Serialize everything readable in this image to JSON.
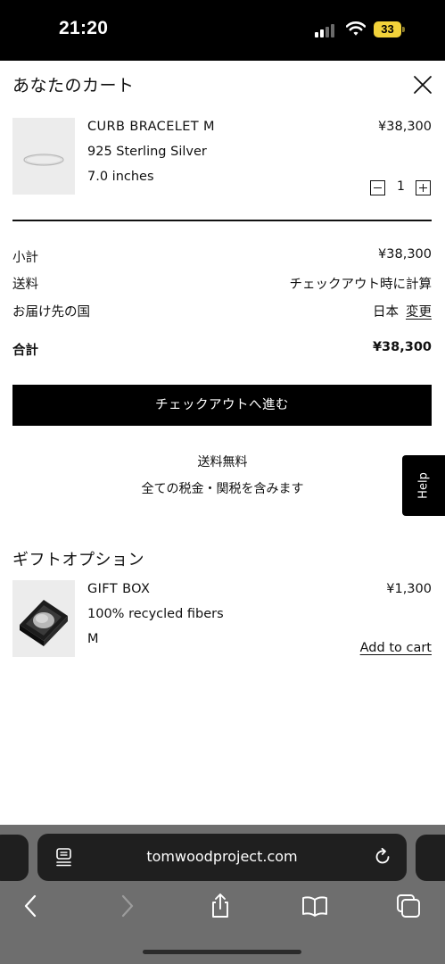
{
  "status_bar": {
    "time": "21:20",
    "battery": "33",
    "battery_color": "#f2d23a"
  },
  "cart": {
    "title": "あなたのカート"
  },
  "product": {
    "name": "CURB BRACELET M",
    "material": "925 Sterling Silver",
    "size": "7.0 inches",
    "price": "¥38,300",
    "quantity": "1"
  },
  "summary": {
    "subtotal_label": "小計",
    "subtotal_value": "¥38,300",
    "shipping_label": "送料",
    "shipping_value": "チェックアウト時に計算",
    "country_label": "お届け先の国",
    "country_value": "日本",
    "change_label": "変更",
    "total_label": "合計",
    "total_value": "¥38,300"
  },
  "checkout_button": "チェックアウトへ進む",
  "notes": {
    "free_shipping": "送料無料",
    "tax_included": "全ての税金・関税を含みます"
  },
  "help_label": "Help",
  "gift": {
    "section_title": "ギフトオプション",
    "name": "GIFT BOX",
    "material": "100% recycled fibers",
    "size": "M",
    "price": "¥1,300",
    "add_to_cart": "Add to cart"
  },
  "browser": {
    "url": "tomwoodproject.com"
  },
  "icons": [
    "signal-icon",
    "wifi-icon",
    "battery-icon",
    "close-icon",
    "bracelet-image",
    "gift-box-image",
    "reader-mode-icon",
    "reload-icon",
    "back-icon",
    "forward-icon",
    "share-icon",
    "bookmarks-icon",
    "tabs-icon"
  ]
}
